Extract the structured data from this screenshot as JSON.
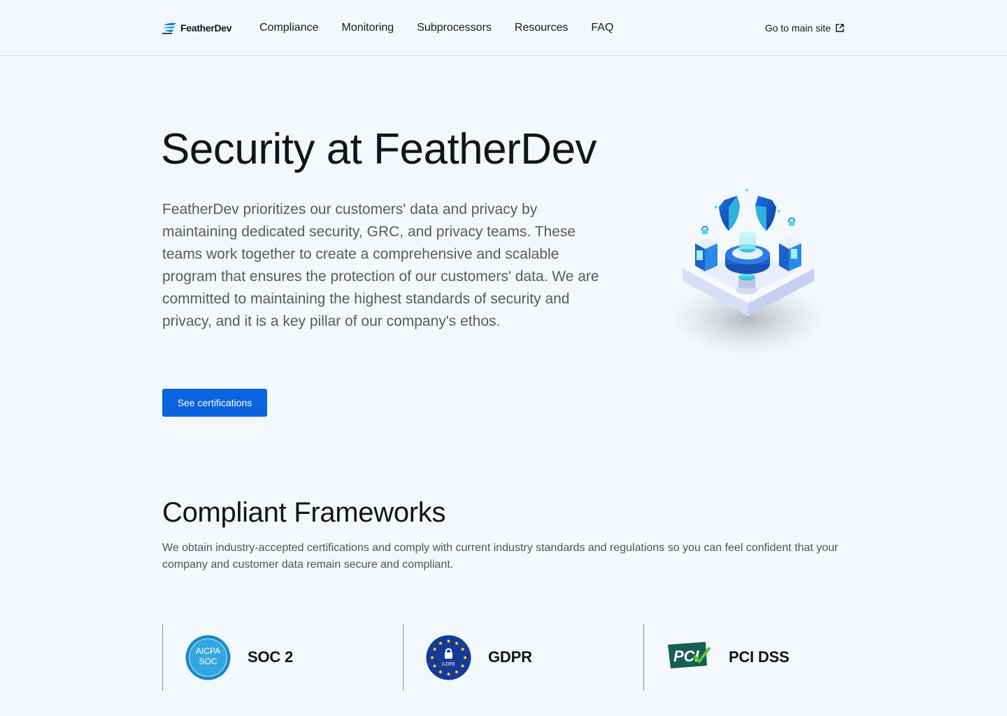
{
  "header": {
    "brand": "FeatherDev",
    "nav": [
      {
        "label": "Compliance"
      },
      {
        "label": "Monitoring"
      },
      {
        "label": "Subprocessors"
      },
      {
        "label": "Resources"
      },
      {
        "label": "FAQ"
      }
    ],
    "main_site_label": "Go to main site",
    "main_site_icon": "external-link-icon"
  },
  "hero": {
    "title": "Security at FeatherDev",
    "body": "FeatherDev prioritizes our customers' data and privacy by maintaining dedicated security, GRC, and privacy teams. These teams work together to create a comprehensive and scalable program that ensures the protection of our customers' data. We are committed to maintaining the highest standards of security and privacy, and it is a key pillar of our company's ethos.",
    "cta_label": "See certifications",
    "illustration": "isometric-security-server-illustration"
  },
  "frameworks": {
    "title": "Compliant Frameworks",
    "description": "We obtain industry-accepted certifications and comply with current industry standards and regulations so you can feel confident that your company and customer data remain secure and compliant.",
    "items": [
      {
        "name": "SOC 2",
        "badge": "aicpa-soc-badge",
        "badge_text_line1": "AICPA",
        "badge_text_line2": "SOC"
      },
      {
        "name": "GDPR",
        "badge": "gdpr-badge",
        "badge_text": "GDPR"
      },
      {
        "name": "PCI DSS",
        "badge": "pci-badge",
        "badge_text": "PCI"
      }
    ]
  },
  "colors": {
    "background": "#f3f8fd",
    "accent": "#0c63de",
    "text": "#141414",
    "muted_text": "#555b62"
  }
}
